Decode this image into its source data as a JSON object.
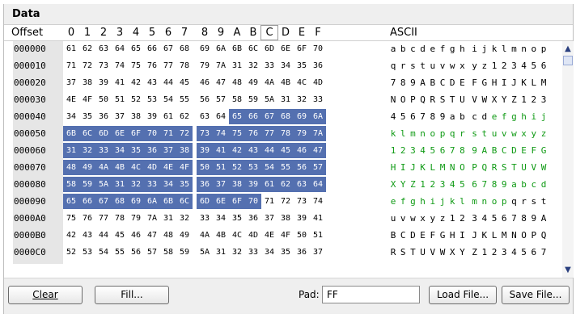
{
  "panel": {
    "title": "Data"
  },
  "header": {
    "offset_label": "Offset",
    "columns": [
      "0",
      "1",
      "2",
      "3",
      "4",
      "5",
      "6",
      "7",
      "8",
      "9",
      "A",
      "B",
      "C",
      "D",
      "E",
      "F"
    ],
    "active_column": "C",
    "ascii_label": "ASCII"
  },
  "rows": [
    {
      "offset": "000000",
      "bytes": [
        "61",
        "62",
        "63",
        "64",
        "65",
        "66",
        "67",
        "68",
        "69",
        "6A",
        "6B",
        "6C",
        "6D",
        "6E",
        "6F",
        "70"
      ],
      "ascii": "abcdefghijklmnop"
    },
    {
      "offset": "000010",
      "bytes": [
        "71",
        "72",
        "73",
        "74",
        "75",
        "76",
        "77",
        "78",
        "79",
        "7A",
        "31",
        "32",
        "33",
        "34",
        "35",
        "36"
      ],
      "ascii": "qrstuvwxyz123456"
    },
    {
      "offset": "000020",
      "bytes": [
        "37",
        "38",
        "39",
        "41",
        "42",
        "43",
        "44",
        "45",
        "46",
        "47",
        "48",
        "49",
        "4A",
        "4B",
        "4C",
        "4D"
      ],
      "ascii": "789ABCDEFGHIJKLM"
    },
    {
      "offset": "000030",
      "bytes": [
        "4E",
        "4F",
        "50",
        "51",
        "52",
        "53",
        "54",
        "55",
        "56",
        "57",
        "58",
        "59",
        "5A",
        "31",
        "32",
        "33"
      ],
      "ascii": "NOPQRSTUVWXYZ123"
    },
    {
      "offset": "000040",
      "bytes": [
        "34",
        "35",
        "36",
        "37",
        "38",
        "39",
        "61",
        "62",
        "63",
        "64",
        "65",
        "66",
        "67",
        "68",
        "69",
        "6A"
      ],
      "ascii": "456789abcdefghij"
    },
    {
      "offset": "000050",
      "bytes": [
        "6B",
        "6C",
        "6D",
        "6E",
        "6F",
        "70",
        "71",
        "72",
        "73",
        "74",
        "75",
        "76",
        "77",
        "78",
        "79",
        "7A"
      ],
      "ascii": "klmnopqrstuvwxyz"
    },
    {
      "offset": "000060",
      "bytes": [
        "31",
        "32",
        "33",
        "34",
        "35",
        "36",
        "37",
        "38",
        "39",
        "41",
        "42",
        "43",
        "44",
        "45",
        "46",
        "47"
      ],
      "ascii": "123456789ABCDEFG"
    },
    {
      "offset": "000070",
      "bytes": [
        "48",
        "49",
        "4A",
        "4B",
        "4C",
        "4D",
        "4E",
        "4F",
        "50",
        "51",
        "52",
        "53",
        "54",
        "55",
        "56",
        "57"
      ],
      "ascii": "HIJKLMNOPQRSTUVW"
    },
    {
      "offset": "000080",
      "bytes": [
        "58",
        "59",
        "5A",
        "31",
        "32",
        "33",
        "34",
        "35",
        "36",
        "37",
        "38",
        "39",
        "61",
        "62",
        "63",
        "64"
      ],
      "ascii": "XYZ123456789abcd"
    },
    {
      "offset": "000090",
      "bytes": [
        "65",
        "66",
        "67",
        "68",
        "69",
        "6A",
        "6B",
        "6C",
        "6D",
        "6E",
        "6F",
        "70",
        "71",
        "72",
        "73",
        "74"
      ],
      "ascii": "efghijklmnopqrst"
    },
    {
      "offset": "0000A0",
      "bytes": [
        "75",
        "76",
        "77",
        "78",
        "79",
        "7A",
        "31",
        "32",
        "33",
        "34",
        "35",
        "36",
        "37",
        "38",
        "39",
        "41"
      ],
      "ascii": "uvwxyz123456789A"
    },
    {
      "offset": "0000B0",
      "bytes": [
        "42",
        "43",
        "44",
        "45",
        "46",
        "47",
        "48",
        "49",
        "4A",
        "4B",
        "4C",
        "4D",
        "4E",
        "4F",
        "50",
        "51"
      ],
      "ascii": "BCDEFGHIJKLMNOPQ"
    },
    {
      "offset": "0000C0",
      "bytes": [
        "52",
        "53",
        "54",
        "55",
        "56",
        "57",
        "58",
        "59",
        "5A",
        "31",
        "32",
        "33",
        "34",
        "35",
        "36",
        "37"
      ],
      "ascii": "RSTUVWXYZ1234567"
    }
  ],
  "selection": {
    "start": 74,
    "end": 156
  },
  "colors": {
    "selection_bg": "#5470B0",
    "selection_text": "#FFFFFF",
    "ascii_selected": "#0F9A14"
  },
  "icons": {
    "scroll_up": "triangle-up-icon",
    "scroll_down": "triangle-down-icon"
  },
  "toolbar": {
    "clear_label": "Clear",
    "fill_label": "Fill...",
    "pad_label": "Pad:",
    "pad_value": "FF",
    "load_label": "Load File...",
    "save_label": "Save File..."
  }
}
